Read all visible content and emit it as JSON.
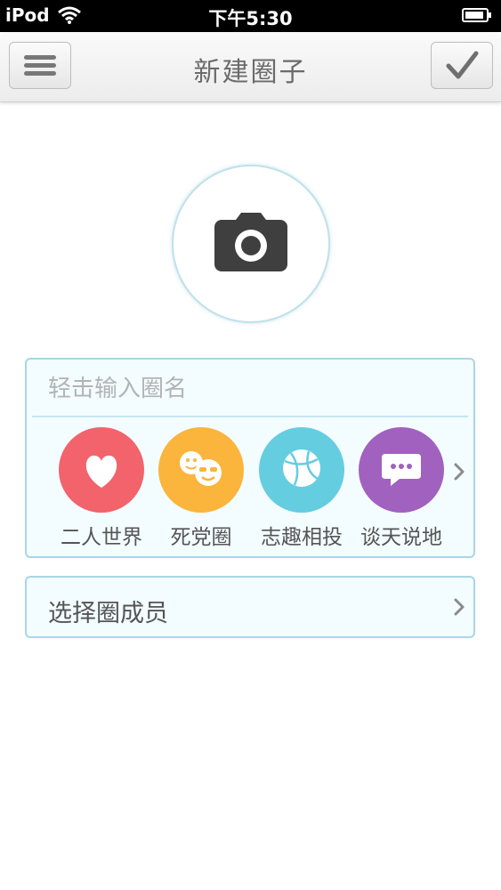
{
  "status_bar": {
    "carrier": "iPod",
    "time": "下午5:30"
  },
  "nav": {
    "title": "新建圈子",
    "menu_icon": "hamburger-menu-icon",
    "done_icon": "checkmark-icon"
  },
  "photo": {
    "icon": "camera-icon"
  },
  "name_input": {
    "placeholder": "轻击输入圈名",
    "value": ""
  },
  "categories": [
    {
      "label": "二人世界",
      "icon": "heart-icon",
      "color": "#f2636b"
    },
    {
      "label": "死党圈",
      "icon": "smiley-faces-icon",
      "color": "#fbb43c"
    },
    {
      "label": "志趣相投",
      "icon": "basketball-icon",
      "color": "#64cde0"
    },
    {
      "label": "谈天说地",
      "icon": "chat-bubble-icon",
      "color": "#a161bf"
    }
  ],
  "members": {
    "label": "选择圈成员"
  },
  "colors": {
    "card_border": "#a9d6e6",
    "card_bg": "#f3fcff"
  }
}
